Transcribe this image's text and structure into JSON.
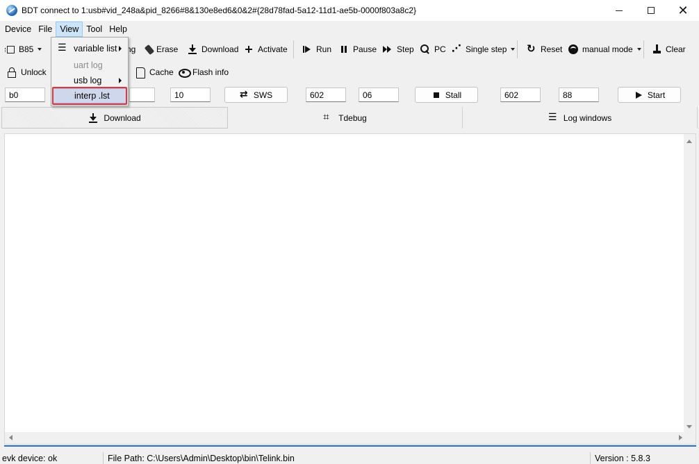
{
  "window": {
    "title": "BDT connect to 1:usb#vid_248a&pid_8266#8&130e8ed6&0&2#{28d78fad-5a12-11d1-ae5b-0000f803a8c2}",
    "controls": {
      "minimize": "",
      "maximize": "",
      "close": "✕"
    }
  },
  "menubar": {
    "items": [
      {
        "label": "Device"
      },
      {
        "label": "File"
      },
      {
        "label": "View"
      },
      {
        "label": "Tool"
      },
      {
        "label": "Help"
      }
    ]
  },
  "view_menu": {
    "items": [
      {
        "label": "variable list",
        "submenu": true,
        "enabled": true
      },
      {
        "label": "uart log",
        "submenu": false,
        "enabled": false
      },
      {
        "label": "usb log",
        "submenu": true,
        "enabled": true
      },
      {
        "label": "interp .lst",
        "submenu": false,
        "enabled": true,
        "highlighted": true
      }
    ]
  },
  "toolbar1": {
    "chip_select": "B85",
    "partial_label": "ng",
    "erase": "Erase",
    "download": "Download",
    "activate": "Activate",
    "run": "Run",
    "pause": "Pause",
    "step": "Step",
    "pc": "PC",
    "single_step": "Single step",
    "reset": "Reset",
    "manual_mode": "manual mode",
    "clear": "Clear"
  },
  "toolbar2": {
    "unlock": "Unlock",
    "cache": "Cache",
    "flash_info": "Flash info"
  },
  "row3": {
    "field1": "b0",
    "field2": "10",
    "sws_button": "SWS",
    "field3": "602",
    "field4": "06",
    "stall_button": "Stall",
    "field5": "602",
    "field6": "88",
    "start_button": "Start"
  },
  "tabs": [
    {
      "label": "Download",
      "active": true
    },
    {
      "label": "Tdebug",
      "active": false
    },
    {
      "label": "Log windows",
      "active": false
    }
  ],
  "status": {
    "device": "evk device: ok",
    "file_path": "File Path:  C:\\Users\\Admin\\Desktop\\bin\\Telink.bin",
    "version": "Version : 5.8.3"
  },
  "colors": {
    "highlight_box": "#e0353f",
    "menu_active": "#cce4f7",
    "accent_line": "#2b6cc4"
  }
}
